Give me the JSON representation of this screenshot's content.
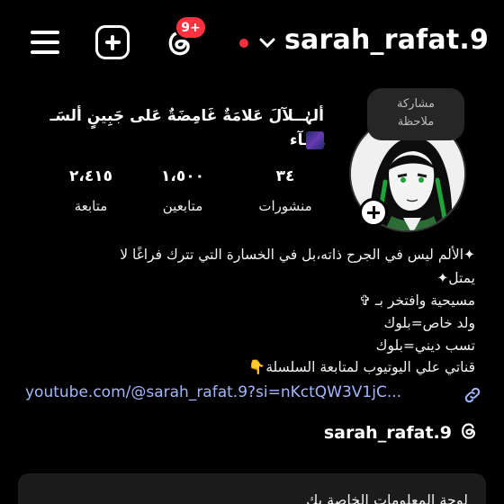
{
  "header": {
    "username": "sarah_rafat.9",
    "notifications_badge": "9+",
    "icons": [
      "menu-icon",
      "add-icon",
      "threads-icon",
      "chevron-down-icon"
    ]
  },
  "profile": {
    "name_line1": "ألہٰــلآلَ عَلامَةٌ غَامِضَةٌ عَلى جَبِينٍ ألسَـ",
    "name_line2": "ـمَـآء",
    "note": {
      "line1": "مشاركة",
      "line2": "ملاحظة"
    },
    "stats": [
      {
        "value": "٣٤",
        "label": "منشورات"
      },
      {
        "value": "١،٥٠٠",
        "label": "متابعين"
      },
      {
        "value": "٢،٤١٥",
        "label": "متابعة"
      }
    ]
  },
  "bio": {
    "line1": "✦الألم ليس في الجرح ذاته،بل في الخسارة التي تترك فراغًا لا",
    "line2": "يمتل✦",
    "line3": "مسيحية وافتخر بـ ✞",
    "line4": "ولد خاص=بلوك",
    "line5": "تسب ديني=بلوك",
    "line6": "قناتي علي اليوتيوب لمتابعة السلسلة👇",
    "link": "youtube.com/@sarah_rafat.9?si=nKctQW3V1jC..."
  },
  "threads": {
    "label": "sarah_rafat.9"
  },
  "professional": {
    "text": "لوحة المعلومات الخاصة بك"
  }
}
